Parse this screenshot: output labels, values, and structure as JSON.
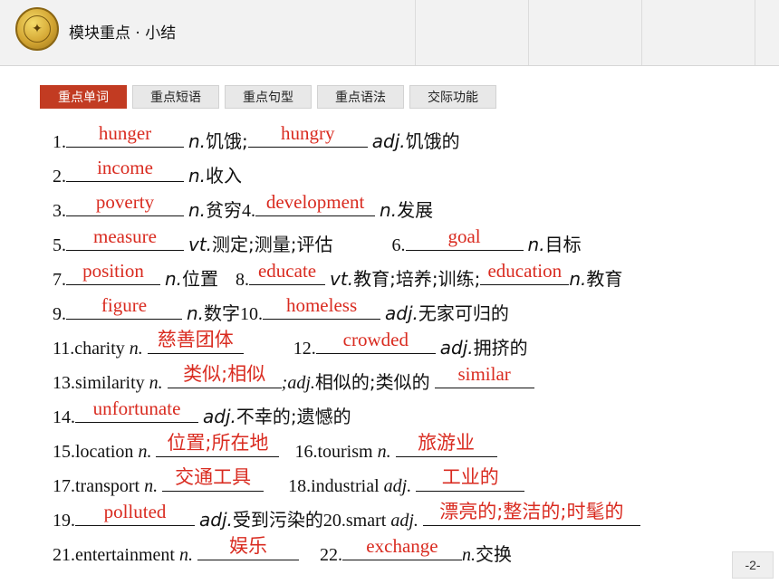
{
  "header": {
    "title": "模块重点 · 小结"
  },
  "tabs": [
    {
      "label": "重点单词",
      "active": true
    },
    {
      "label": "重点短语",
      "active": false
    },
    {
      "label": "重点句型",
      "active": false
    },
    {
      "label": "重点语法",
      "active": false
    },
    {
      "label": "交际功能",
      "active": false
    }
  ],
  "lines": [
    {
      "n1": "1.",
      "a1": "hunger",
      "p1": "n.",
      "c1": "饥饿;",
      "a2": "hungry",
      "p2": "adj.",
      "c2": "饥饿的"
    },
    {
      "n1": "2.",
      "a1": "income",
      "p1": "n.",
      "c1": "收入"
    },
    {
      "n1": "3.",
      "a1": "poverty",
      "p1": "n.",
      "c1": "贫穷",
      "n2": "4.",
      "a2": "development",
      "p2": "n.",
      "c2": "发展"
    },
    {
      "n1": "5.",
      "a1": "measure",
      "p1": "vt.",
      "c1": "测定;测量;评估",
      "n2": "6.",
      "a2": "goal",
      "p2": "n.",
      "c2": "目标"
    },
    {
      "n1": "7.",
      "a1": "position",
      "p1": "n.",
      "c1": "位置",
      "n2": "8.",
      "a2": "educate",
      "p2": "vt.",
      "c2": "教育;培养;训练;",
      "a3": "education",
      "p3": "n.",
      "c3": "教育"
    },
    {
      "n1": "9.",
      "a1": "figure",
      "p1": "n.",
      "c1": "数字",
      "n2": "10.",
      "a2": "homeless",
      "p2": "adj.",
      "c2": "无家可归的"
    },
    {
      "w1": "11.charity",
      "p1": "n.",
      "a1": "慈善团体",
      "n2": "12.",
      "a2": "crowded",
      "p2": "adj.",
      "c2": "拥挤的"
    },
    {
      "w1": "13.similarity",
      "p1": "n.",
      "a1": "类似;相似",
      "t1": ";adj.",
      "c1": "相似的;类似的",
      "a2": "similar"
    },
    {
      "n1": "14.",
      "a1": "unfortunate",
      "p1": "adj.",
      "c1": "不幸的;遗憾的"
    },
    {
      "w1": "15.location",
      "p1": "n.",
      "a1": "位置;所在地",
      "w2": "16.tourism",
      "p2": "n.",
      "a2": "旅游业"
    },
    {
      "w1": "17.transport",
      "p1": "n.",
      "a1": "交通工具",
      "w2": "18.industrial",
      "p2": "adj.",
      "a2": "工业的"
    },
    {
      "n1": "19.",
      "a1": "polluted",
      "p1": "adj.",
      "c1": "受到污染的",
      "w2": "20.smart",
      "p2": "adj.",
      "a2": "漂亮的;整洁的;时髦的"
    },
    {
      "w1": "21.entertainment",
      "p1": "n.",
      "a1": "娱乐",
      "n2": "22.",
      "a2": "exchange",
      "p2": "n.",
      "c2": "交换"
    }
  ],
  "page_number": "-2-"
}
